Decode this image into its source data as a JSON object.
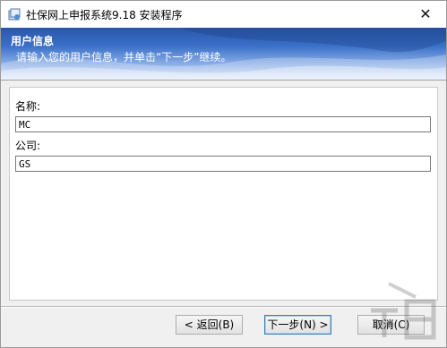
{
  "window": {
    "title": "社保网上申报系统9.18 安装程序",
    "close_glyph": "✕"
  },
  "banner": {
    "title": "用户信息",
    "subtitle": "请输入您的用户信息，并单击“下一步”继续。"
  },
  "form": {
    "name_label": "名称:",
    "name_value": "MC",
    "company_label": "公司:",
    "company_value": "GS"
  },
  "buttons": {
    "back": "< 返回(B)",
    "next": "下一步(N) >",
    "cancel": "取消(C)"
  },
  "colors": {
    "banner_top": "#2a56a8",
    "banner_bottom": "#dde7f7",
    "window_bg": "#f0f0f0",
    "default_button_border": "#3c7fb1"
  }
}
